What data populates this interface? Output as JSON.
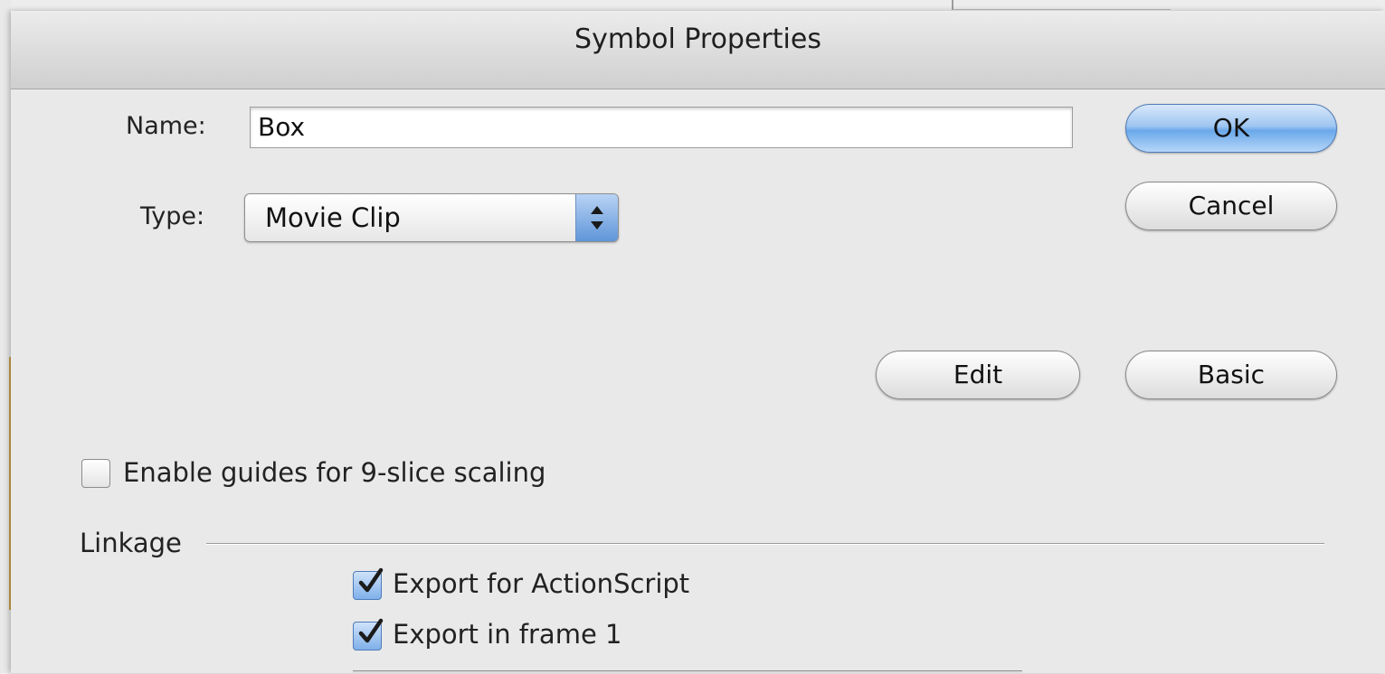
{
  "dialog": {
    "title": "Symbol Properties"
  },
  "form": {
    "name_label": "Name:",
    "name_value": "Box",
    "type_label": "Type:",
    "type_value": "Movie Clip"
  },
  "buttons": {
    "ok": "OK",
    "cancel": "Cancel",
    "edit": "Edit",
    "basic": "Basic"
  },
  "options": {
    "nine_slice_label": "Enable guides for 9-slice scaling",
    "nine_slice_checked": false
  },
  "linkage": {
    "section_label": "Linkage",
    "export_actionscript_label": "Export for ActionScript",
    "export_actionscript_checked": true,
    "export_frame1_label": "Export in frame 1",
    "export_frame1_checked": true
  },
  "colors": {
    "accent_blue": "#6aa8ea",
    "window_bg": "#e9e9e9"
  }
}
